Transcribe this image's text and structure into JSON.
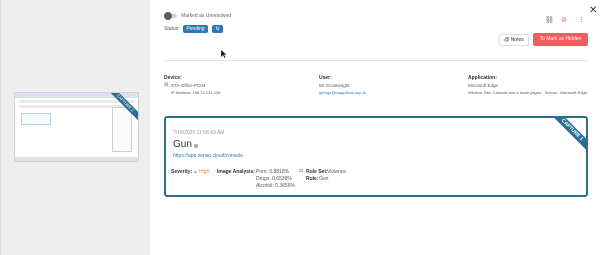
{
  "left_panel": {
    "thumbnail_ribbon": "CAPTURE 1"
  },
  "toolbar": {
    "close_icon": "close-icon",
    "toggle_label": "Marked as Unresolved",
    "status_label": "Status:",
    "status_value": "Pending",
    "status_alt": "⇅",
    "icons": [
      "link-icon",
      "alert-icon",
      "more-icon"
    ],
    "notes_label": "@ Notes",
    "mark_hidden_label": "To Mark as Hidden"
  },
  "info": {
    "device_label": "Device:",
    "device_name": "STA-Office-PC04",
    "device_ip": "IP Address: 196.74.131.226",
    "user_label": "User:",
    "user_name": "Mr GCartwright",
    "user_email": "george@magnifical.org.uk",
    "app_label": "Application:",
    "app_name": "Microsoft Edge",
    "window_title": "Window Title: Console and 4 more pages - School - Microsoft Edge"
  },
  "card": {
    "ribbon": "CAPTURE 1",
    "timestamp": "7/18/2025 11:58:43 AM",
    "title": "Gun",
    "url": "https://app.senso.cloud/console",
    "severity_label": "Severity:",
    "severity_value": "High",
    "image_analysis_label": "Image Analysis:",
    "analysis": [
      "Porn: 5.8818%",
      "Drugs: 0.6539%",
      "Alcohol: 0.3656%"
    ],
    "rule_set_label": "Rule Set:",
    "rule_set_value": "Violence",
    "rule_label": "Rule:",
    "rule_value": "Gun"
  },
  "colors": {
    "accent": "#2b6f91",
    "button_blue": "#2b7ab1",
    "danger": "#f05d5d",
    "severity": "#f08a24"
  }
}
